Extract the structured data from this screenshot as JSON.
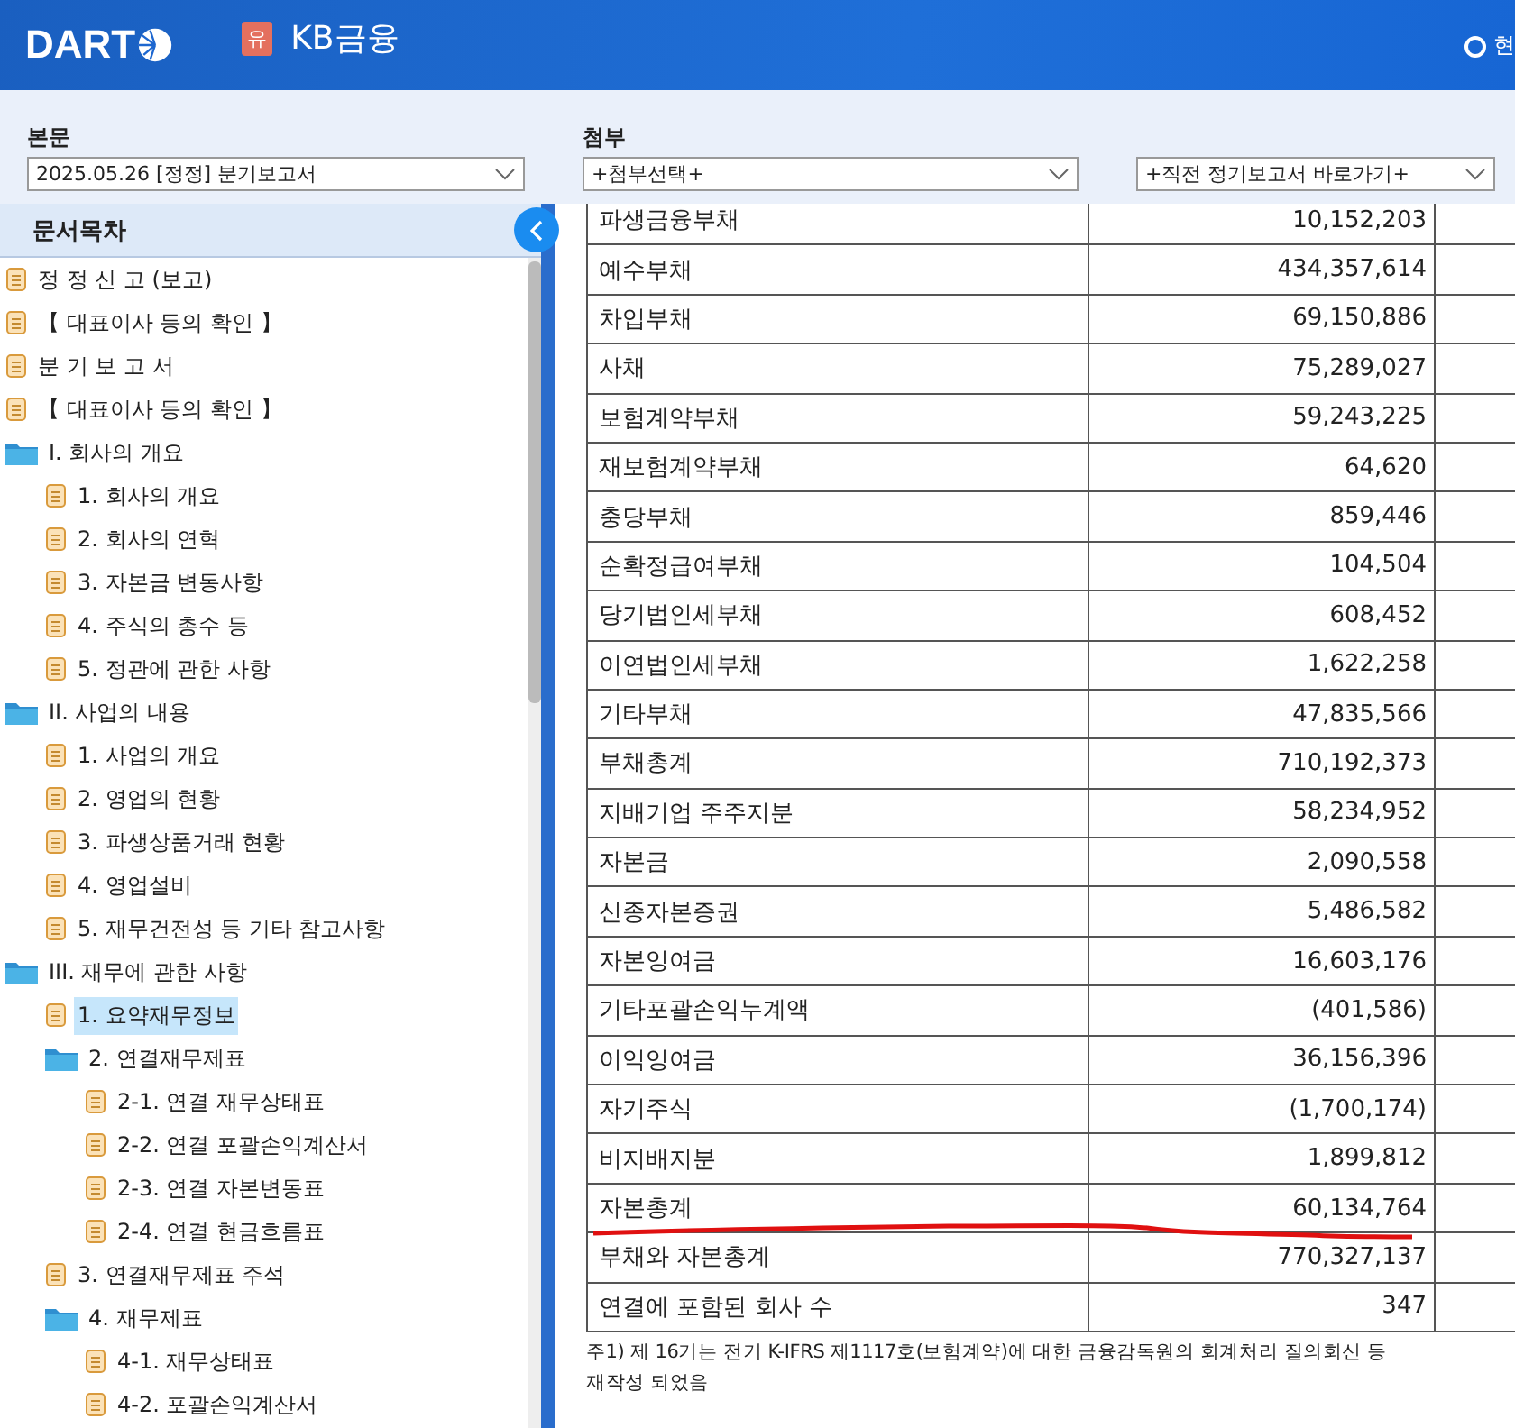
{
  "header": {
    "logo": "DART",
    "badge": "유",
    "company": "KB금융",
    "right_label": "현"
  },
  "selectors": [
    {
      "label": "본문",
      "value": "2025.05.26 [정정] 분기보고서"
    },
    {
      "label": "첨부",
      "value": "+첨부선택+"
    },
    {
      "value": "+직전 정기보고서 바로가기+"
    }
  ],
  "sidebar": {
    "title": "문서목차",
    "items": [
      {
        "kind": "doc",
        "label": "정 정 신 고 (보고)",
        "selected": false
      },
      {
        "kind": "doc",
        "label": "【 대표이사 등의 확인 】",
        "selected": false
      },
      {
        "kind": "doc",
        "label": "분 기 보 고 서",
        "selected": false
      },
      {
        "kind": "doc",
        "label": "【 대표이사 등의 확인 】",
        "selected": false
      },
      {
        "kind": "folder",
        "label": "I. 회사의 개요",
        "selected": false,
        "children": [
          {
            "kind": "doc",
            "label": "1. 회사의 개요",
            "selected": false
          },
          {
            "kind": "doc",
            "label": "2. 회사의 연혁",
            "selected": false
          },
          {
            "kind": "doc",
            "label": "3. 자본금 변동사항",
            "selected": false
          },
          {
            "kind": "doc",
            "label": "4. 주식의 총수 등",
            "selected": false
          },
          {
            "kind": "doc",
            "label": "5. 정관에 관한 사항",
            "selected": false
          }
        ]
      },
      {
        "kind": "folder",
        "label": "II. 사업의 내용",
        "selected": false,
        "children": [
          {
            "kind": "doc",
            "label": "1. 사업의 개요",
            "selected": false
          },
          {
            "kind": "doc",
            "label": "2. 영업의 현황",
            "selected": false
          },
          {
            "kind": "doc",
            "label": "3. 파생상품거래 현황",
            "selected": false
          },
          {
            "kind": "doc",
            "label": "4. 영업설비",
            "selected": false
          },
          {
            "kind": "doc",
            "label": "5. 재무건전성 등 기타 참고사항",
            "selected": false
          }
        ]
      },
      {
        "kind": "folder",
        "label": "III. 재무에 관한 사항",
        "selected": false,
        "children": [
          {
            "kind": "doc",
            "label": "1. 요약재무정보",
            "selected": true
          },
          {
            "kind": "folder",
            "label": "2. 연결재무제표",
            "selected": false,
            "children": [
              {
                "kind": "doc",
                "label": "2-1. 연결 재무상태표",
                "selected": false
              },
              {
                "kind": "doc",
                "label": "2-2. 연결 포괄손익계산서",
                "selected": false
              },
              {
                "kind": "doc",
                "label": "2-3. 연결 자본변동표",
                "selected": false
              },
              {
                "kind": "doc",
                "label": "2-4. 연결 현금흐름표",
                "selected": false
              }
            ]
          },
          {
            "kind": "doc",
            "label": "3. 연결재무제표 주석",
            "selected": false
          },
          {
            "kind": "folder",
            "label": "4. 재무제표",
            "selected": false,
            "children": [
              {
                "kind": "doc",
                "label": "4-1. 재무상태표",
                "selected": false
              },
              {
                "kind": "doc",
                "label": "4-2. 포괄손익계산서",
                "selected": false
              }
            ]
          }
        ]
      }
    ]
  },
  "table": {
    "rows": [
      {
        "label": "파생금융부채",
        "value": "10,152,203",
        "marked": false
      },
      {
        "label": "예수부채",
        "value": "434,357,614",
        "marked": false
      },
      {
        "label": "차입부채",
        "value": "69,150,886",
        "marked": false
      },
      {
        "label": "사채",
        "value": "75,289,027",
        "marked": false
      },
      {
        "label": "보험계약부채",
        "value": "59,243,225",
        "marked": false
      },
      {
        "label": "재보험계약부채",
        "value": "64,620",
        "marked": false
      },
      {
        "label": "충당부채",
        "value": "859,446",
        "marked": false
      },
      {
        "label": "순확정급여부채",
        "value": "104,504",
        "marked": false
      },
      {
        "label": "당기법인세부채",
        "value": "608,452",
        "marked": false
      },
      {
        "label": "이연법인세부채",
        "value": "1,622,258",
        "marked": false
      },
      {
        "label": "기타부채",
        "value": "47,835,566",
        "marked": false
      },
      {
        "label": "부채총계",
        "value": "710,192,373",
        "marked": false
      },
      {
        "label": "지배기업 주주지분",
        "value": "58,234,952",
        "marked": false
      },
      {
        "label": "자본금",
        "value": "2,090,558",
        "marked": false
      },
      {
        "label": "신종자본증권",
        "value": "5,486,582",
        "marked": false
      },
      {
        "label": "자본잉여금",
        "value": "16,603,176",
        "marked": false
      },
      {
        "label": "기타포괄손익누계액",
        "value": "(401,586)",
        "marked": false
      },
      {
        "label": "이익잉여금",
        "value": "36,156,396",
        "marked": false
      },
      {
        "label": "자기주식",
        "value": "(1,700,174)",
        "marked": false
      },
      {
        "label": "비지배지분",
        "value": "1,899,812",
        "marked": false
      },
      {
        "label": "자본총계",
        "value": "60,134,764",
        "marked": true
      },
      {
        "label": "부채와 자본총계",
        "value": "770,327,137",
        "marked": false
      },
      {
        "label": "연결에 포함된 회사 수",
        "value": "347",
        "marked": false
      }
    ],
    "footnote": "주1) 제 16기는 전기 K-IFRS 제1117호(보험계약)에 대한 금융감독원의 회계처리 질의회신 등",
    "footnote_2": "재작성 되었음"
  }
}
